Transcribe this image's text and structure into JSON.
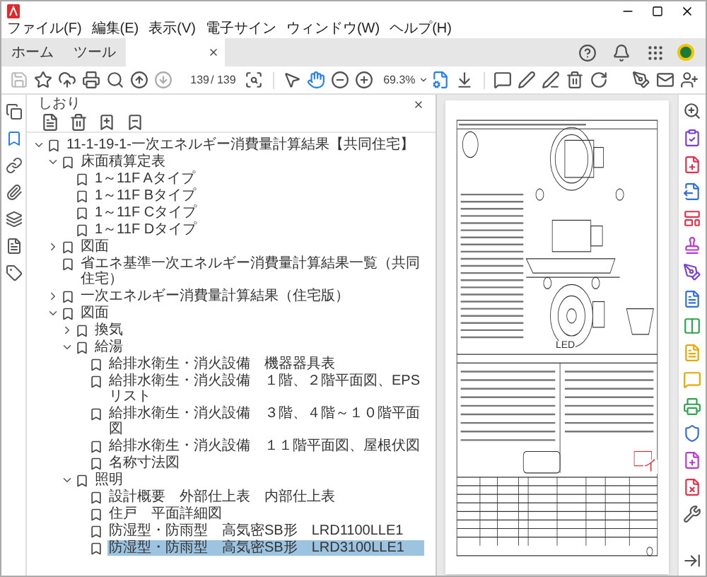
{
  "menu": [
    "ファイル(F)",
    "編集(E)",
    "表示(V)",
    "電子サイン",
    "ウィンドウ(W)",
    "ヘルプ(H)"
  ],
  "tabs": [
    {
      "label": "ホーム"
    },
    {
      "label": "ツール"
    }
  ],
  "toolbar": {
    "page": "139",
    "page_total": "/ 139",
    "zoom": "69.3%"
  },
  "nav_icons": [
    {
      "kind": "pages",
      "selected": false
    },
    {
      "kind": "bookmarks",
      "selected": true
    },
    {
      "kind": "links",
      "selected": false
    },
    {
      "kind": "attachments",
      "selected": false
    },
    {
      "kind": "layers",
      "selected": false
    },
    {
      "kind": "content",
      "selected": false
    },
    {
      "kind": "tags",
      "selected": false
    }
  ],
  "side_panel": {
    "title": "しおり"
  },
  "bookmarks": [
    {
      "label": "11-1-19-1-一次エネルギー消費量計算結果【共同住宅】",
      "selected": false,
      "expanded": true,
      "children": [
        {
          "label": "床面積算定表",
          "selected": false,
          "expanded": true,
          "children": [
            {
              "label": "1～11F Aタイプ",
              "selected": false
            },
            {
              "label": "1～11F Bタイプ",
              "selected": false
            },
            {
              "label": "1～11F Cタイプ",
              "selected": false
            },
            {
              "label": "1～11F Dタイプ",
              "selected": false
            }
          ]
        },
        {
          "label": "図面",
          "selected": false,
          "expanded": false
        },
        {
          "label": "省エネ基準一次エネルギー消費量計算結果一覧（共同住宅）",
          "selected": false
        },
        {
          "label": "一次エネルギー消費量計算結果（住宅版）",
          "selected": false,
          "expanded": false
        },
        {
          "label": "図面",
          "selected": false,
          "expanded": true,
          "children": [
            {
              "label": "換気",
              "selected": false,
              "expanded": false
            },
            {
              "label": "給湯",
              "selected": false,
              "expanded": true,
              "children": [
                {
                  "label": "給排水衛生・消火設備　機器器具表",
                  "selected": false
                },
                {
                  "label": "給排水衛生・消火設備　１階、２階平面図、EPSリスト",
                  "selected": false
                },
                {
                  "label": "給排水衛生・消火設備　３階、４階～１０階平面図",
                  "selected": false
                },
                {
                  "label": "給排水衛生・消火設備　１１階平面図、屋根伏図",
                  "selected": false
                },
                {
                  "label": "名称寸法図",
                  "selected": false
                }
              ]
            },
            {
              "label": "照明",
              "selected": false,
              "expanded": true,
              "children": [
                {
                  "label": "設計概要　外部仕上表　内部仕上表",
                  "selected": false
                },
                {
                  "label": "住戸　平面詳細図",
                  "selected": false
                },
                {
                  "label": "防湿型・防雨型　高気密SB形　LRD1100LLE1",
                  "selected": false
                },
                {
                  "label": "防湿型・防雨型　高気密SB形　LRD3100LLE1",
                  "selected": true
                }
              ]
            }
          ]
        }
      ]
    }
  ],
  "document": {
    "labels": [
      "LED",
      "イ"
    ]
  }
}
